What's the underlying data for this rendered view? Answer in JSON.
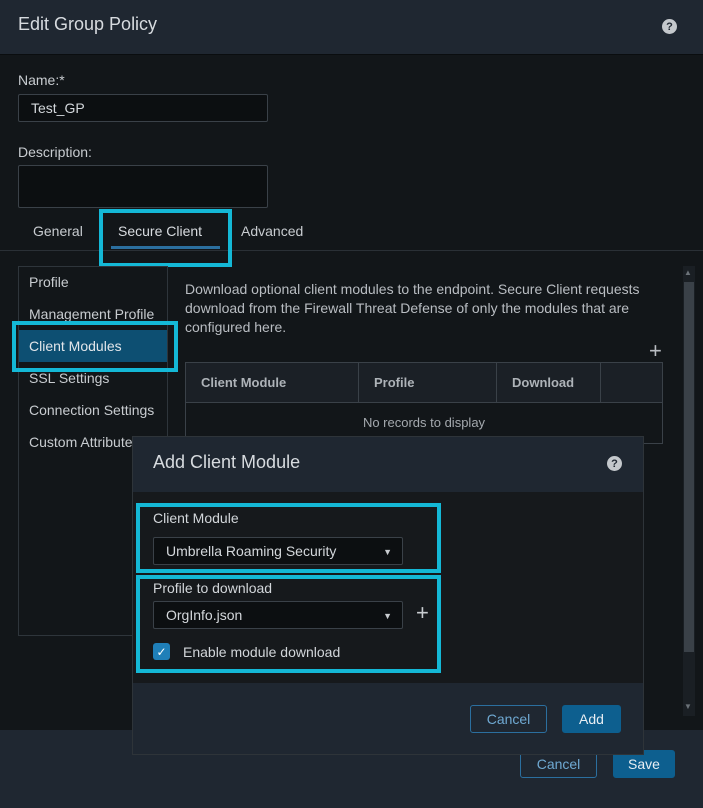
{
  "dialog": {
    "title": "Edit Group Policy",
    "help_glyph": "?",
    "help_icon": "question-circle-icon"
  },
  "form": {
    "name_label": "Name:*",
    "name_value": "Test_GP",
    "description_label": "Description:",
    "description_value": ""
  },
  "tabs": [
    {
      "label": "General",
      "active": false
    },
    {
      "label": "Secure Client",
      "active": true
    },
    {
      "label": "Advanced",
      "active": false
    }
  ],
  "side_nav": {
    "items": [
      {
        "label": "Profile",
        "selected": false
      },
      {
        "label": "Management Profile",
        "selected": false
      },
      {
        "label": "Client Modules",
        "selected": true
      },
      {
        "label": "SSL Settings",
        "selected": false
      },
      {
        "label": "Connection Settings",
        "selected": false
      },
      {
        "label": "Custom Attributes",
        "selected": false
      }
    ]
  },
  "client_modules": {
    "description": "Download optional client modules to the endpoint. Secure Client requests download from the Firewall Threat Defense of only the modules that are configured here.",
    "add_glyph": "+",
    "table": {
      "columns": [
        "Client Module",
        "Profile",
        "Download",
        ""
      ],
      "empty_text": "No records to display"
    }
  },
  "footer": {
    "cancel_label": "Cancel",
    "save_label": "Save"
  },
  "modal": {
    "title": "Add Client Module",
    "client_module_label": "Client Module",
    "client_module_value": "Umbrella Roaming Security",
    "profile_label": "Profile to download",
    "profile_value": "OrgInfo.json",
    "add_profile_glyph": "+",
    "enable_download_label": "Enable module download",
    "enable_download_checked": true,
    "cancel_label": "Cancel",
    "add_label": "Add"
  },
  "colors": {
    "accent": "#0d5f8f",
    "highlight": "#14b8d6",
    "selected_nav": "#0d4f72"
  }
}
